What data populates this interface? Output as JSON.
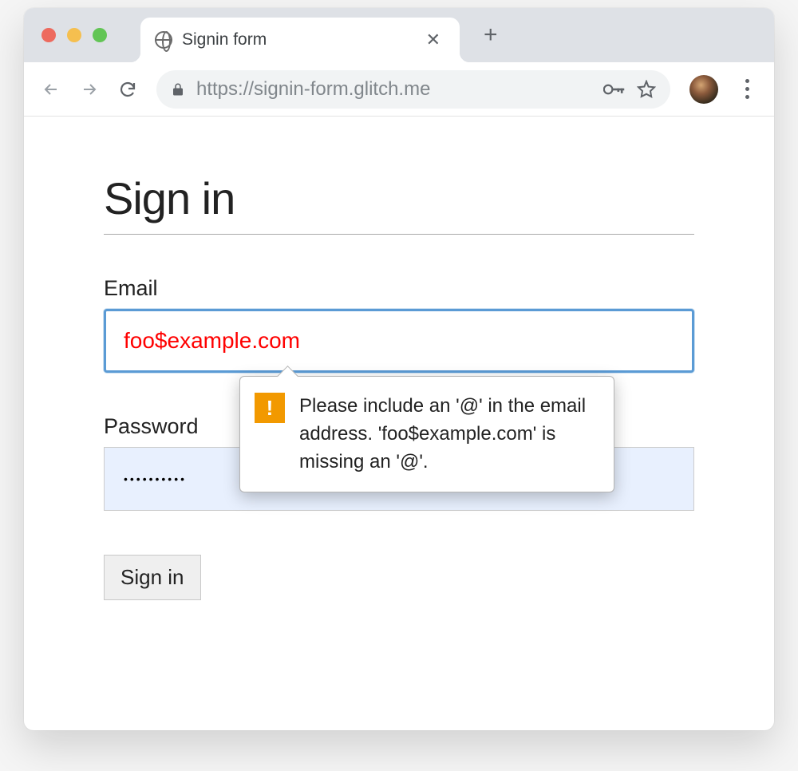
{
  "browser": {
    "tab_title": "Signin form",
    "url": "https://signin-form.glitch.me"
  },
  "page": {
    "heading": "Sign in",
    "email_label": "Email",
    "email_value": "foo$example.com",
    "password_label": "Password",
    "password_value": "••••••••••",
    "submit_label": "Sign in"
  },
  "tooltip": {
    "icon_glyph": "!",
    "message": "Please include an '@' in the email address. 'foo$example.com' is missing an '@'."
  }
}
